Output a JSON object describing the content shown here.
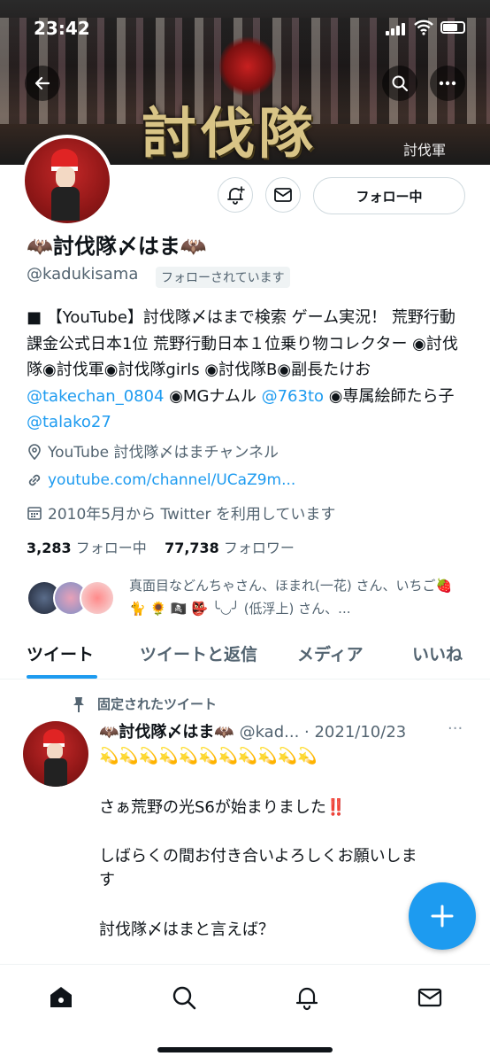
{
  "status_bar": {
    "time": "23:42"
  },
  "banner": {
    "title": "討伐隊",
    "subtitle": "討伐軍"
  },
  "profile": {
    "display_name": "🦇討伐隊〆はま🦇",
    "handle": "@kadukisama",
    "follows_you": "フォローされています",
    "follow_button": "フォロー中",
    "bio": {
      "part1": "■ 【YouTube】討伐隊〆はまで検索 ゲーム実況！ 荒野行動課金公式日本1位 荒野行動日本１位乗り物コレクター ◉討伐隊◉討伐軍◉討伐隊girls ◉討伐隊B◉副長たけお ",
      "mention1": "@takechan_0804",
      "part2": " ◉MGナムル ",
      "mention2": "@763to",
      "part3": " ◉専属絵師たら子 ",
      "mention3": "@talako27"
    },
    "location": "YouTube 討伐隊〆はまチャンネル",
    "url": "youtube.com/channel/UCaZ9m...",
    "joined": "2010年5月から Twitter を利用しています",
    "following_count": "3,283",
    "following_label": "フォロー中",
    "followers_count": "77,738",
    "followers_label": "フォロワー",
    "followers_you_know": "真面目などんちゃさん、ほまれ(一花) さん、いちご🍓 🐈 🌻 🏴‍☠️ 👺 ╰◡╯ (低浮上) さん、..."
  },
  "tabs": [
    "ツイート",
    "ツイートと返信",
    "メディア",
    "いいね"
  ],
  "pinned_tweet": {
    "pinned_label": "固定されたツイート",
    "author_name": "🦇討伐隊〆はま🦇",
    "author_handle": "@kad...",
    "date": "· 2021/10/23",
    "more": "···",
    "lines": [
      "💫💫💫💫💫💫💫💫💫💫💫",
      "さぁ荒野の光S6が始まりました‼️",
      "しばらくの間お付き合いよろしくお願いしま",
      "す",
      "討伐隊〆はまと言えば？"
    ]
  },
  "fab": {
    "icon": "plus-icon"
  },
  "colors": {
    "accent": "#1d9bf0",
    "text": "#0f1419",
    "secondary": "#536471"
  }
}
